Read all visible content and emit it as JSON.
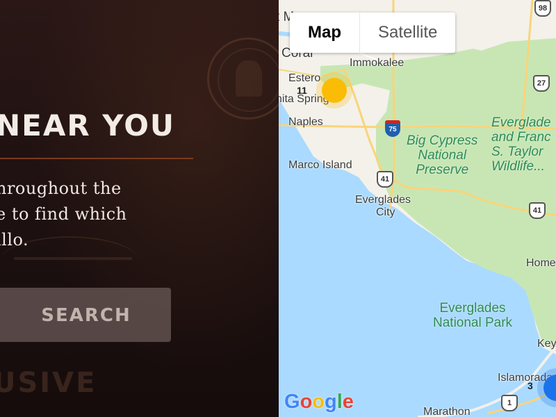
{
  "dealer_locator": {
    "heading": "NEAR YOU",
    "body_lines": [
      "hroughout the",
      "e to find which",
      "illo."
    ],
    "search_label": "SEARCH",
    "faded_text": "USIVE"
  },
  "map": {
    "toggle": {
      "map_label": "Map",
      "satellite_label": "Satellite",
      "active": "Map"
    },
    "places": {
      "fort_myers": "t Myers",
      "cape_coral": "Coral",
      "immokalee": "Immokalee",
      "estero": "Estero",
      "bonita_springs": "nita Springs",
      "naples": "Naples",
      "marco_island": "Marco Island",
      "everglades_city_1": "Everglades",
      "everglades_city_2": "City",
      "homestead": "Home",
      "key_largo": "Key",
      "islamorada": "Islamorada",
      "marathon": "Marathon"
    },
    "parks": {
      "big_cypress": [
        "Big Cypress",
        "National",
        "Preserve"
      ],
      "everglades_wildlife": [
        "Everglade",
        "and Franc",
        "S. Taylor",
        "Wildlife..."
      ],
      "everglades_np": [
        "Everglades",
        "National Park"
      ]
    },
    "road_shields": {
      "i75": "75",
      "us41_a": "41",
      "us41_b": "41",
      "us41_c": "41",
      "r27": "27",
      "r98": "98",
      "us1": "1"
    },
    "clusters": [
      {
        "label": "11",
        "color": "#fbbc05"
      },
      {
        "label": "3",
        "color": "#1a73e8"
      }
    ],
    "logo": "Google",
    "colors": {
      "water": "#aadaff",
      "land": "#f3f1ea",
      "park": "#c8e6b4",
      "road": "#f9d47a"
    }
  }
}
